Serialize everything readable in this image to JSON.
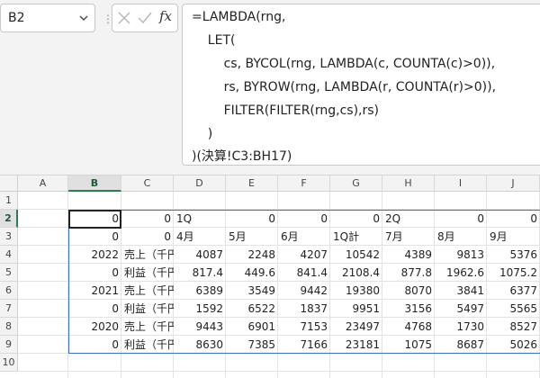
{
  "name_box": {
    "value": "B2"
  },
  "formula_bar": {
    "fx_label": "fx",
    "lines": [
      "=LAMBDA(rng,",
      "    LET(",
      "        cs, BYCOL(rng, LAMBDA(c, COUNTA(c)>0)),",
      "        rs, BYROW(rng, LAMBDA(r, COUNTA(r)>0)),",
      "        FILTER(FILTER(rng,cs),rs)",
      "    )",
      ")(決算!C3:BH17)"
    ]
  },
  "sheet": {
    "columns": [
      "A",
      "B",
      "C",
      "D",
      "E",
      "F",
      "G",
      "H",
      "I",
      "J"
    ],
    "rows": [
      "1",
      "2",
      "3",
      "4",
      "5",
      "6",
      "7",
      "8",
      "9",
      "10"
    ],
    "selected_column": "B",
    "selected_row": "2",
    "cells": [
      [
        "",
        "",
        "",
        "",
        "",
        "",
        "",
        "",
        "",
        ""
      ],
      [
        "",
        "0",
        "0",
        "1Q",
        "0",
        "0",
        "0",
        "2Q",
        "0",
        "0"
      ],
      [
        "",
        "0",
        "0",
        "4月",
        "5月",
        "6月",
        "1Q計",
        "7月",
        "8月",
        "9月"
      ],
      [
        "",
        "2022",
        "売上（千円）",
        "4087",
        "2248",
        "4207",
        "10542",
        "4389",
        "9813",
        "5376"
      ],
      [
        "",
        "0",
        "利益（千円）",
        "817.4",
        "449.6",
        "841.4",
        "2108.4",
        "877.8",
        "1962.6",
        "1075.2"
      ],
      [
        "",
        "2021",
        "売上（千円）",
        "6389",
        "3549",
        "9442",
        "19380",
        "8070",
        "3841",
        "6377"
      ],
      [
        "",
        "0",
        "利益（千円）",
        "1592",
        "6522",
        "1837",
        "9951",
        "3156",
        "5497",
        "5565"
      ],
      [
        "",
        "2020",
        "売上（千円）",
        "9443",
        "6901",
        "7153",
        "23497",
        "4768",
        "1730",
        "8527"
      ],
      [
        "",
        "0",
        "利益（千円）",
        "8630",
        "7385",
        "7166",
        "23181",
        "1075",
        "8687",
        "5026"
      ],
      [
        "",
        "",
        "",
        "",
        "",
        "",
        "",
        "",
        "",
        ""
      ]
    ]
  }
}
